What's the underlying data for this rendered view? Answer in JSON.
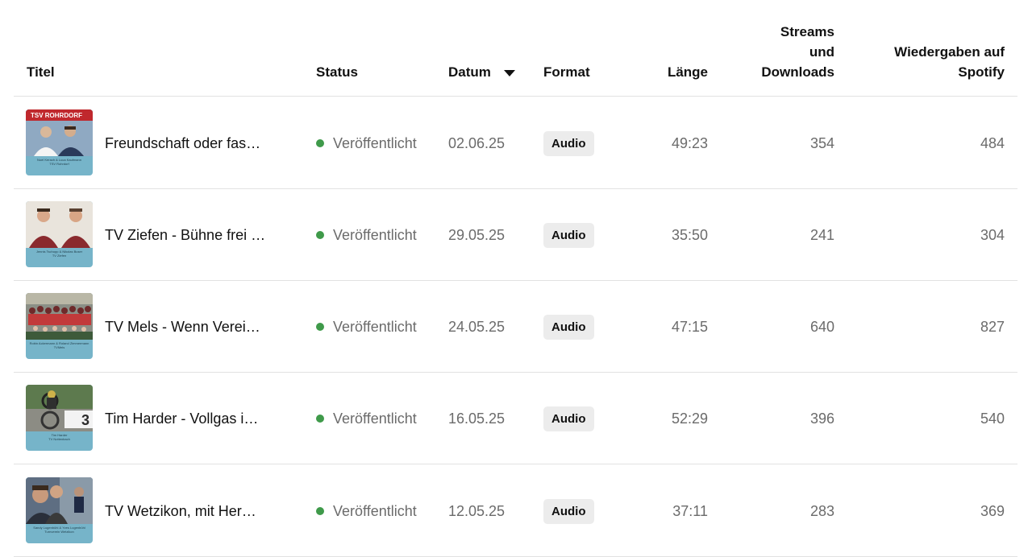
{
  "columns": {
    "title": "Titel",
    "status": "Status",
    "date": "Datum",
    "format": "Format",
    "length": "Länge",
    "streams": "Streams\nund\nDownloads",
    "spotify": "Wiedergaben auf\nSpotify"
  },
  "rows": [
    {
      "title": "Freundschaft oder fas…",
      "status": "Veröffentlicht",
      "date": "02.06.25",
      "format": "Audio",
      "length": "49:23",
      "streams": "354",
      "spotify": "484",
      "thumb_caption": "Noel Kerach & Luca Kaufmann\nTSV Rohrdorf",
      "thumb_banner": "TSV ROHRDORF"
    },
    {
      "title": "TV Ziefen - Bühne frei …",
      "status": "Veröffentlicht",
      "date": "29.05.25",
      "format": "Audio",
      "length": "35:50",
      "streams": "241",
      "spotify": "304",
      "thumb_caption": "Jennis Tschopp & Nikolas Buser\nTV Ziefen"
    },
    {
      "title": "TV Mels - Wenn Verei…",
      "status": "Veröffentlicht",
      "date": "24.05.25",
      "format": "Audio",
      "length": "47:15",
      "streams": "640",
      "spotify": "827",
      "thumb_caption": "Robin Ackermann & Roland Zimmermann\nTVMels"
    },
    {
      "title": "Tim Harder - Vollgas i…",
      "status": "Veröffentlicht",
      "date": "16.05.25",
      "format": "Audio",
      "length": "52:29",
      "streams": "396",
      "spotify": "540",
      "thumb_caption": "Tim Harder\nTV Nottenbach",
      "thumb_overlay": "3"
    },
    {
      "title": "TV Wetzikon, mit Her…",
      "status": "Veröffentlicht",
      "date": "12.05.25",
      "format": "Audio",
      "length": "37:11",
      "streams": "283",
      "spotify": "369",
      "thumb_caption": "Sandy Lugenbühl & Yves Lugenbühl\nTurnverein Wetzikon"
    }
  ],
  "colors": {
    "status_published": "#3f9a4a",
    "thumb_background": "#76b4c9",
    "divider": "#e2e2e2",
    "badge_background": "#ececec"
  },
  "icons": {
    "sort": "sort-desc-arrow-icon",
    "status": "status-dot-icon"
  }
}
